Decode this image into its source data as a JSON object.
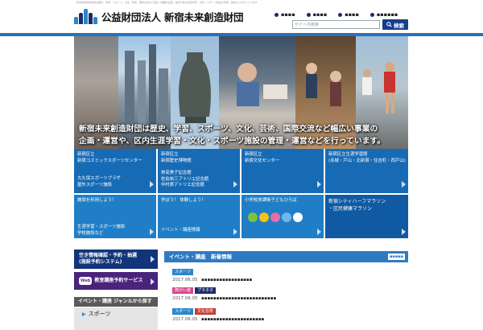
{
  "header": {
    "tiny_strip": "新宿未来創造財団は歴史、学習、スポーツ、文化、芸術、国際交流など幅広い事業の企画・運営や区内生涯学習・文化・スポーツ施設の管理・運営などを行っています",
    "logo_text": "公益財団法人 新宿未来創造財団",
    "nav": [
      "▪▪▪▪",
      "▪▪▪▪",
      "▪▪▪▪",
      "▪▪▪▪▪▪"
    ],
    "search_placeholder": "サイト内検索",
    "search_button": "検索"
  },
  "hero": {
    "line1": "新宿未来創造財団は歴史、学習、スポーツ、文化、芸術、国際交流など幅広い事業の",
    "line2": "企画・運営や、区内生涯学習・文化・スポーツ施設の管理・運営などを行っています。"
  },
  "grid": {
    "c1_title1": "新宿区立",
    "c1_title2": "新宿コズミックスポーツセンター",
    "c1_sub1": "大久保スポーツプラザ",
    "c1_sub2": "屋外スポーツ施設",
    "c2_title1": "新宿区立",
    "c2_title2": "新宿歴史博物館",
    "c2_sub1": "林芙美子記念館",
    "c2_sub2": "佐伯祐三アトリエ記念館",
    "c2_sub3": "中村彝アトリエ記念館",
    "c3_title1": "新宿区立",
    "c3_title2": "新宿文化センター",
    "c4_title1": "新宿区立生涯学習館",
    "c4_title2": "(赤城・戸山・北新宿・住吉町・西戸山)",
    "l1_title": "施設を利用しよう！",
    "l1_sub1": "生涯学習・スポーツ施設",
    "l1_sub2": "学校施設など",
    "l2_title": "学ぼう！ 体験しよう！",
    "l2_sub": "イベント・講座情報",
    "l3_title": "小学校放課後子どもひろば",
    "l4_title1": "新宿シティハーフマラソン",
    "l4_title2": "・区民健康マラソン"
  },
  "sidebar": {
    "btn1_line1": "空き情報確認・予約・抽選",
    "btn1_line2": "(施設予約システム)",
    "btn2_badge": "Web",
    "btn2_label": "教室講座予約サービス",
    "cat_title": "イベント・講座 ジャンルから探す",
    "item1": "スポーツ"
  },
  "news": {
    "title": "イベント・講座　新着情報",
    "more": "▪▪▪▪▪",
    "items": [
      {
        "badges": [
          "スポーツ"
        ],
        "date": "2017.06.05",
        "title": "▪▪▪▪▪▪▪▪▪▪▪▪▪▪▪▪▪"
      },
      {
        "badges": [
          "障がい者",
          "プラネタ"
        ],
        "date": "2017.06.05",
        "title": "▪▪▪▪▪▪▪▪▪▪▪▪▪▪▪▪▪▪▪▪▪▪▪▪▪"
      },
      {
        "badges": [
          "スポーツ",
          "文化芸術"
        ],
        "date": "2017.06.05",
        "title": "▪▪▪▪▪▪▪▪▪▪▪▪▪▪▪▪▪▪▪▪▪"
      }
    ]
  },
  "colors": {
    "brand_navy": "#163d8f",
    "rule_blue": "#2d6fb8",
    "tile_blue": "#176bb5",
    "badge_sports": "#2a85c9",
    "badge_disabled": "#d9488c",
    "badge_planetarium": "#1b2c6b",
    "badge_culture": "#c33c2e"
  }
}
